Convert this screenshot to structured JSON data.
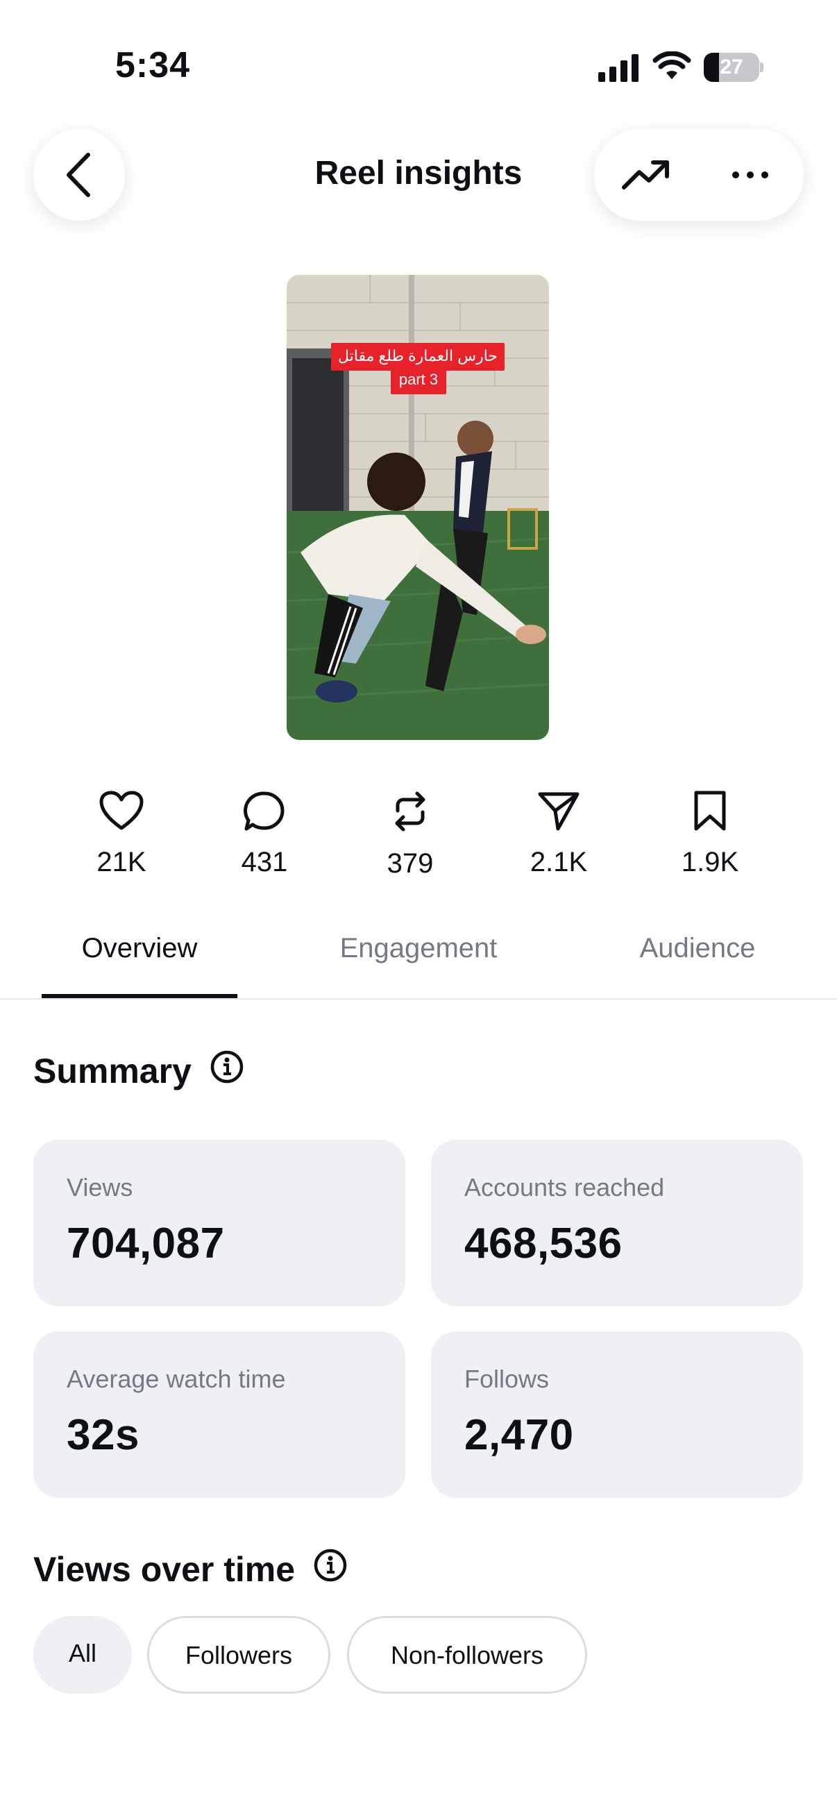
{
  "status_bar": {
    "time": "5:34",
    "battery_level": "27",
    "battery_fraction": 0.27
  },
  "header": {
    "title": "Reel insights"
  },
  "reel": {
    "caption_line1": "حارس العمارة طلع مقاتل",
    "caption_line2": "part 3"
  },
  "stats": {
    "likes": "21K",
    "comments": "431",
    "reposts": "379",
    "shares": "2.1K",
    "saves": "1.9K"
  },
  "tabs": {
    "overview": "Overview",
    "engagement": "Engagement",
    "audience": "Audience",
    "active": "Overview"
  },
  "summary": {
    "title": "Summary",
    "cards": {
      "views": {
        "label": "Views",
        "value": "704,087"
      },
      "reached": {
        "label": "Accounts reached",
        "value": "468,536"
      },
      "watch_time": {
        "label": "Average watch time",
        "value": "32s"
      },
      "follows": {
        "label": "Follows",
        "value": "2,470"
      }
    }
  },
  "views_over_time": {
    "title": "Views over time",
    "filters": {
      "all": "All",
      "followers": "Followers",
      "non_followers": "Non-followers",
      "selected": "All"
    }
  }
}
